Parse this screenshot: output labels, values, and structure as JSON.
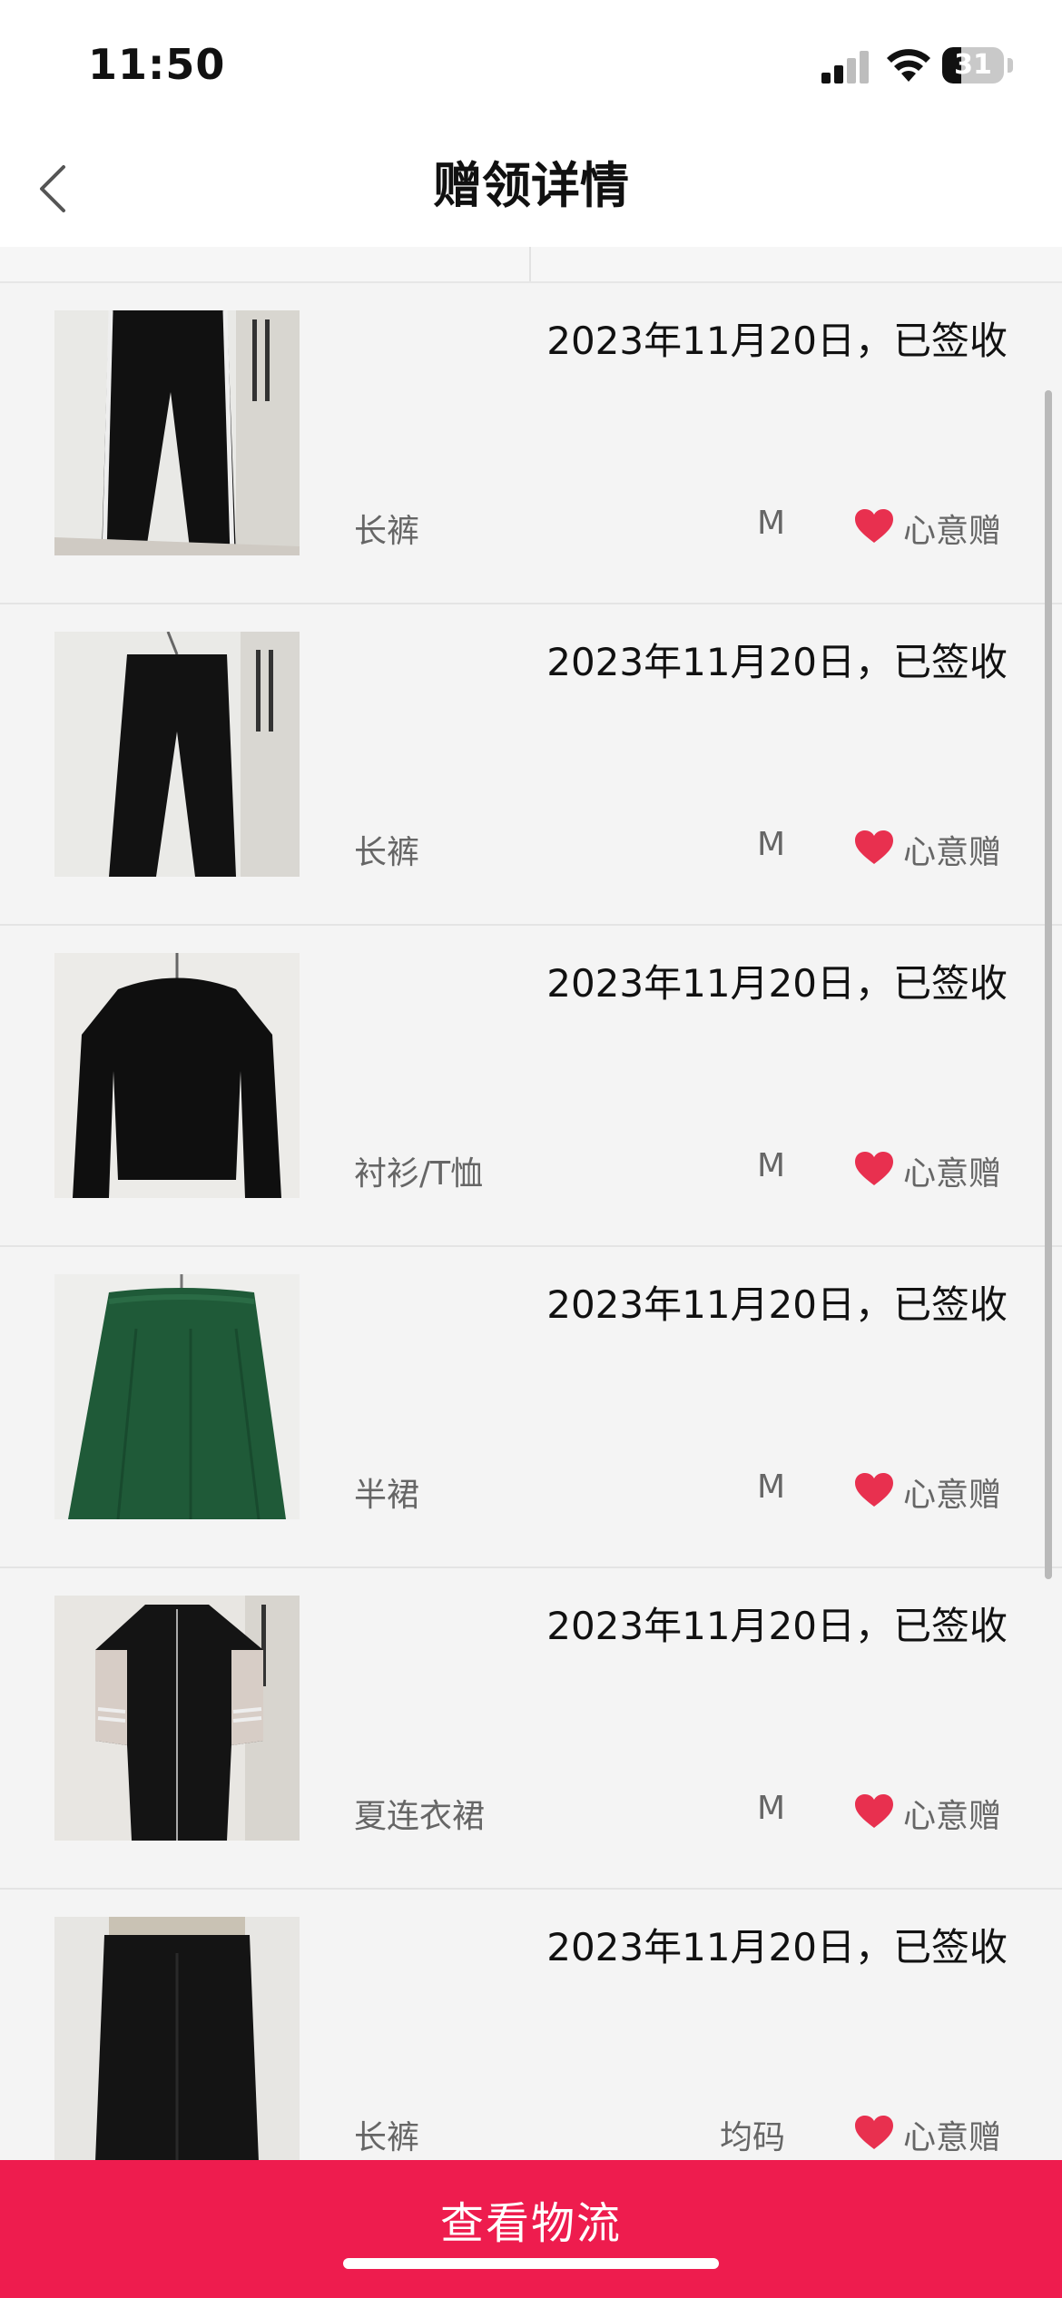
{
  "status_bar": {
    "time": "11:50",
    "battery_level": "31",
    "battery_fraction": 0.31
  },
  "nav": {
    "title": "赠领详情",
    "back_icon": "chevron-left-icon"
  },
  "items": [
    {
      "date": "2023年11月20日，已签收",
      "name": "长裤",
      "size": "M",
      "tag": "心意赠",
      "thumb": "pants"
    },
    {
      "date": "2023年11月20日，已签收",
      "name": "长裤",
      "size": "M",
      "tag": "心意赠",
      "thumb": "pants2"
    },
    {
      "date": "2023年11月20日，已签收",
      "name": "衬衫/T恤",
      "size": "M",
      "tag": "心意赠",
      "thumb": "shirt"
    },
    {
      "date": "2023年11月20日，已签收",
      "name": "半裙",
      "size": "M",
      "tag": "心意赠",
      "thumb": "skirt"
    },
    {
      "date": "2023年11月20日，已签收",
      "name": "夏连衣裙",
      "size": "M",
      "tag": "心意赠",
      "thumb": "dress"
    },
    {
      "date": "2023年11月20日，已签收",
      "name": "长裤",
      "size": "均码",
      "tag": "心意赠",
      "thumb": "pants3"
    }
  ],
  "bottom": {
    "button_label": "查看物流"
  },
  "colors": {
    "accent": "#ee1c4e",
    "heart": "#e8304f",
    "background": "#f4f4f4"
  }
}
